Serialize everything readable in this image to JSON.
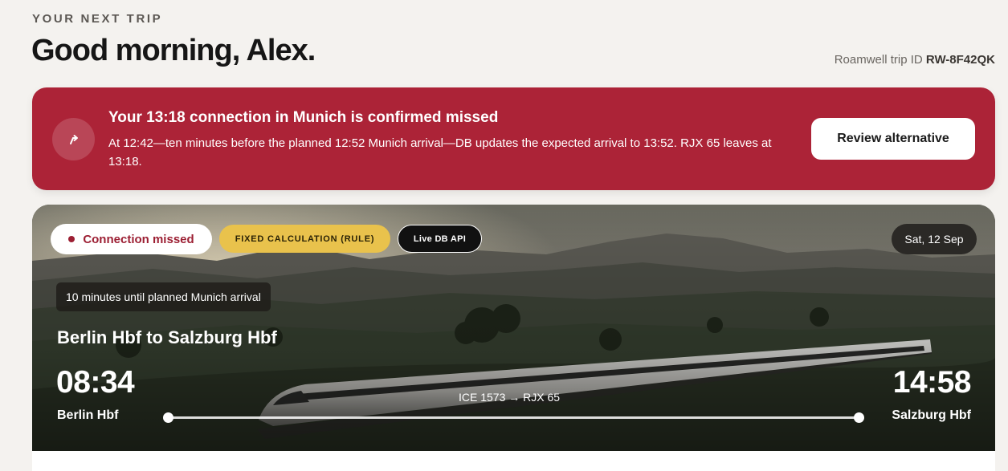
{
  "header": {
    "eyebrow": "YOUR NEXT TRIP",
    "greeting": "Good morning, Alex.",
    "trip_id_label": "Roamwell trip ID",
    "trip_id": "RW-8F42QK"
  },
  "alert": {
    "icon": "redirect-arrow-icon",
    "title": "Your 13:18 connection in Munich is confirmed missed",
    "body": "At 12:42—ten minutes before the planned 12:52 Munich arrival—DB updates the expected arrival to 13:52. RJX 65 leaves at 13:18.",
    "button_label": "Review alternative",
    "color": "#ac2337"
  },
  "trip_card": {
    "status_badge": "Connection missed",
    "calc_badge": "FIXED CALCULATION (RULE)",
    "source_badge": "Live DB API",
    "date": "Sat, 12 Sep",
    "countdown": "10 minutes until planned Munich arrival",
    "route": "Berlin Hbf to Salzburg Hbf",
    "departure_time": "08:34",
    "departure_station": "Berlin Hbf",
    "arrival_time": "14:58",
    "arrival_station": "Salzburg Hbf",
    "trains": "ICE 1573 → RJX 65"
  }
}
